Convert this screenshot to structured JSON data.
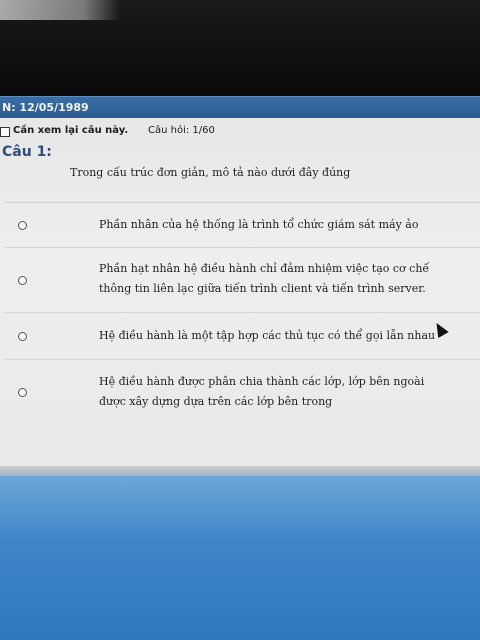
{
  "header": {
    "user_info": "N: 12/05/1989"
  },
  "toolbar": {
    "review_label": "Cần xem lại câu này.",
    "question_counter": "Câu hỏi: 1/60"
  },
  "question": {
    "title": "Câu 1:",
    "text": "Trong cấu trúc đơn giản, mô tả nào dưới đây đúng"
  },
  "answers": [
    {
      "line1": "Phần nhân của hệ thống là trình tổ chức giám sát máy ảo",
      "line2": ""
    },
    {
      "line1": "Phần hạt nhân hệ điều hành chỉ đảm nhiệm việc tạo cơ chế",
      "line2": "thông tin liên lạc giữa tiến trình client và tiến trình server."
    },
    {
      "line1": "Hệ điều hành là một tập hợp các thủ tục có thể gọi lẫn nhau",
      "line2": ""
    },
    {
      "line1": "Hệ điều hành được phân chia thành các lớp, lớp bên ngoài",
      "line2": "được xây dựng dựa trên các lớp bên trong"
    }
  ]
}
